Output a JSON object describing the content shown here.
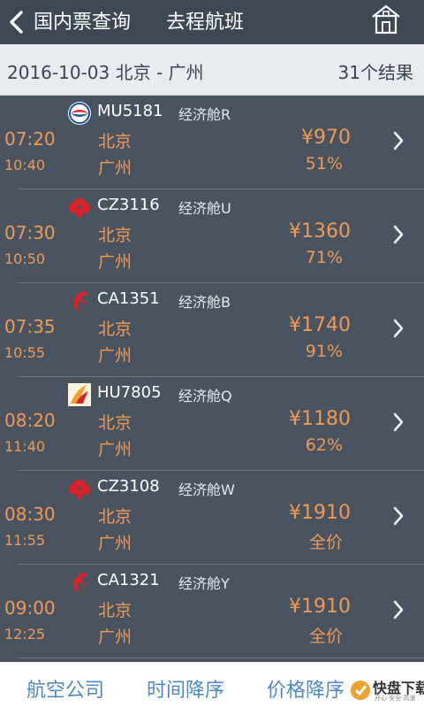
{
  "header": {
    "title": "国内票查询",
    "subtitle": "去程航班"
  },
  "route_bar": {
    "route": "2016-10-03   北京 - 广州",
    "count": "31个结果"
  },
  "flights": [
    {
      "dep": "07:20",
      "arr": "10:40",
      "airline_icon": "china-eastern-logo-icon",
      "flight_no": "MU5181",
      "cabin": "经济舱R",
      "from": "北京",
      "to": "广州",
      "price": "¥970",
      "discount": "51%"
    },
    {
      "dep": "07:30",
      "arr": "10:50",
      "airline_icon": "china-southern-logo-icon",
      "flight_no": "CZ3116",
      "cabin": "经济舱U",
      "from": "北京",
      "to": "广州",
      "price": "¥1360",
      "discount": "71%"
    },
    {
      "dep": "07:35",
      "arr": "10:55",
      "airline_icon": "air-china-logo-icon",
      "flight_no": "CA1351",
      "cabin": "经济舱B",
      "from": "北京",
      "to": "广州",
      "price": "¥1740",
      "discount": "91%"
    },
    {
      "dep": "08:20",
      "arr": "11:40",
      "airline_icon": "hainan-airlines-logo-icon",
      "flight_no": "HU7805",
      "cabin": "经济舱Q",
      "from": "北京",
      "to": "广州",
      "price": "¥1180",
      "discount": "62%"
    },
    {
      "dep": "08:30",
      "arr": "11:55",
      "airline_icon": "china-southern-logo-icon",
      "flight_no": "CZ3108",
      "cabin": "经济舱W",
      "from": "北京",
      "to": "广州",
      "price": "¥1910",
      "discount": "全价"
    },
    {
      "dep": "09:00",
      "arr": "12:25",
      "airline_icon": "air-china-logo-icon",
      "flight_no": "CA1321",
      "cabin": "经济舱Y",
      "from": "北京",
      "to": "广州",
      "price": "¥1910",
      "discount": "全价"
    }
  ],
  "bottom_bar": {
    "airline": "航空公司",
    "time_sort": "时间降序",
    "price_sort": "价格降序"
  },
  "watermark": {
    "text": "快盘下载",
    "sub": "开心·安全·高速"
  },
  "colors": {
    "accent_orange": "#ee9a55",
    "sort_blue": "#4e88c7",
    "list_bg": "#4a5461"
  }
}
